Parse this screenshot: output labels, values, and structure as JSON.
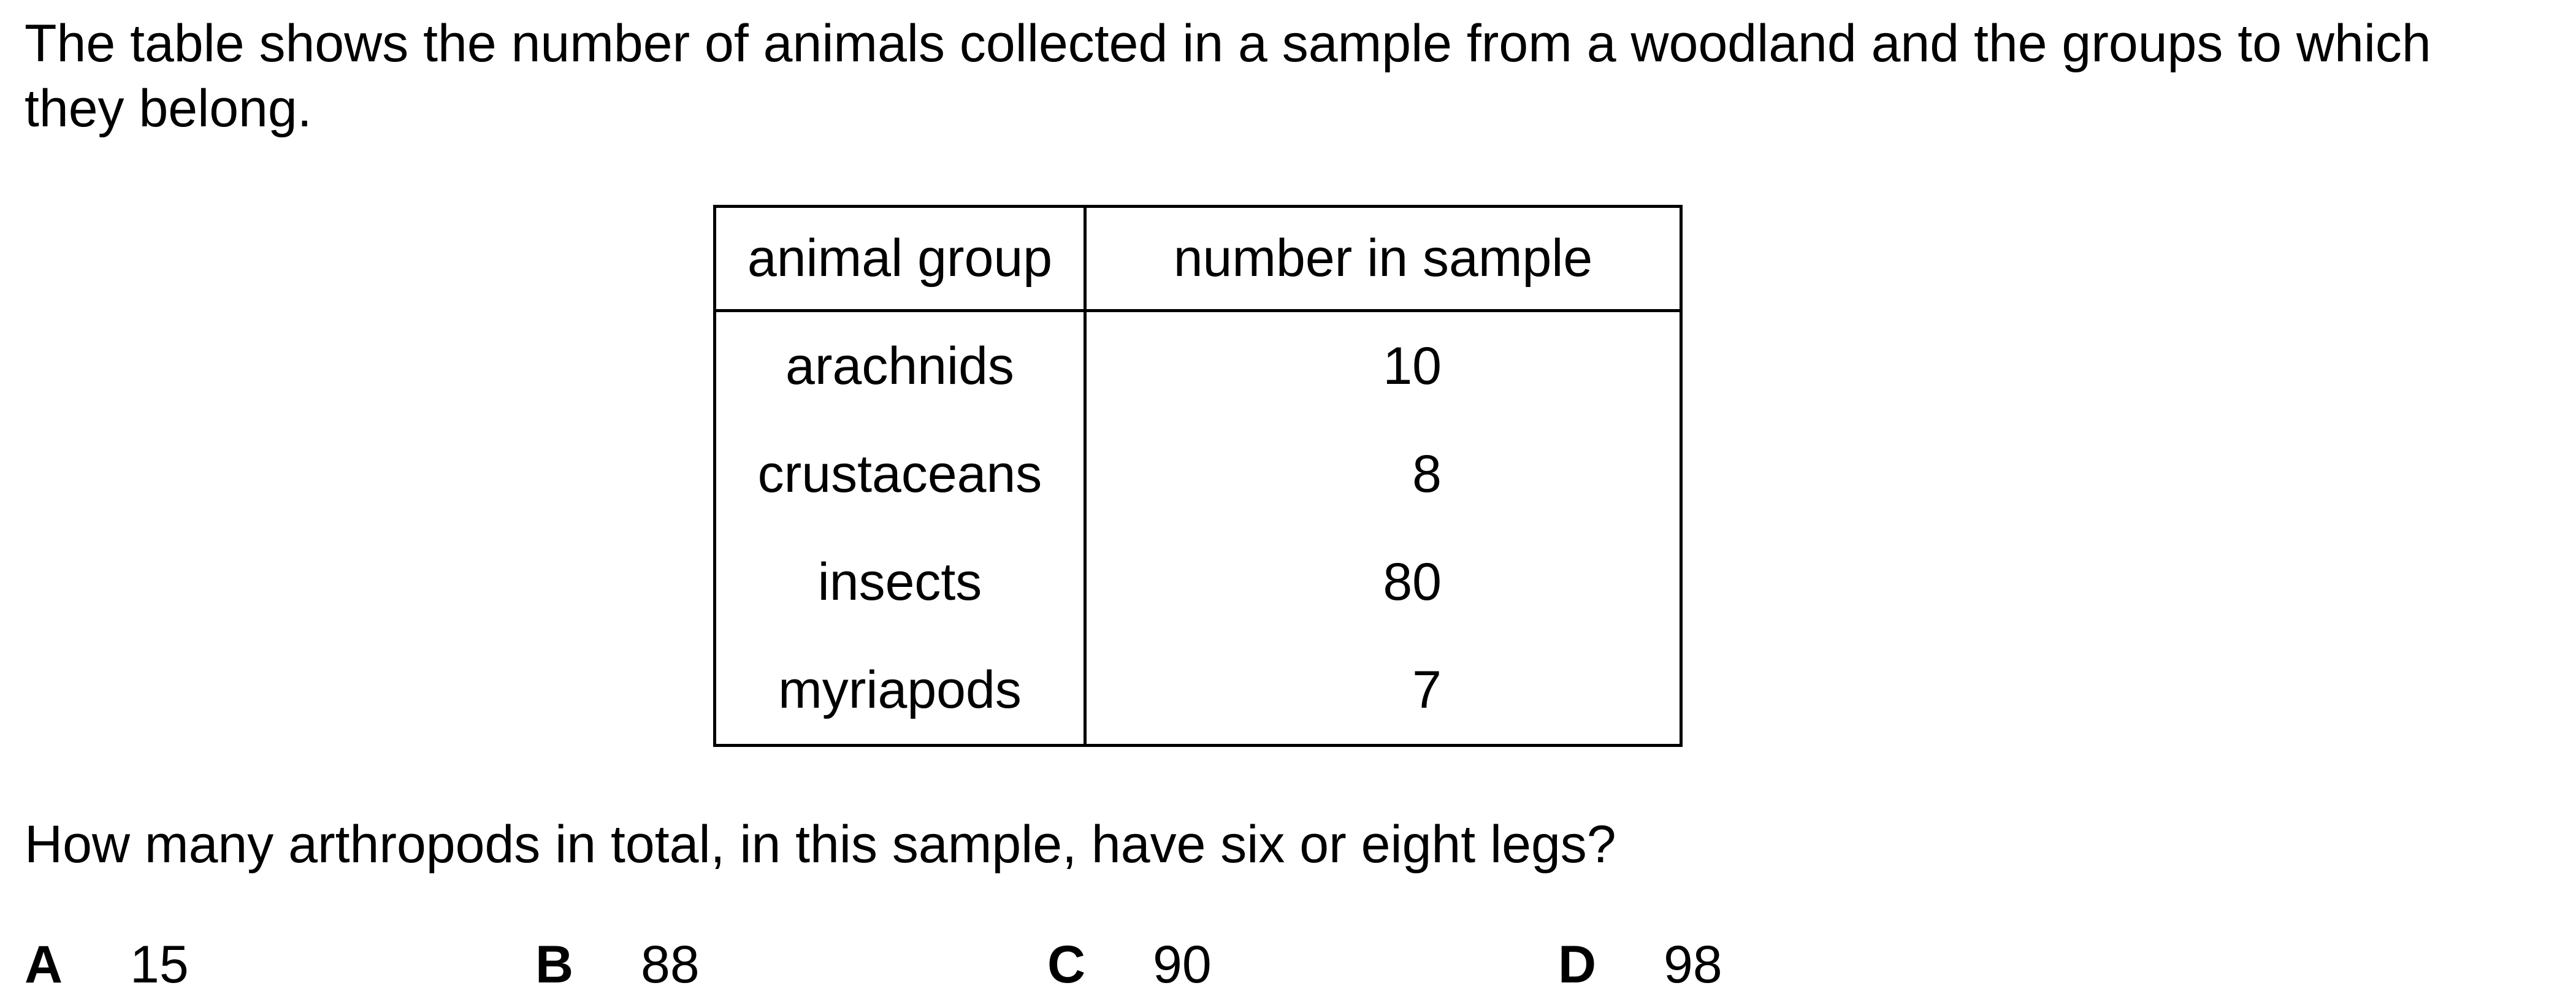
{
  "intro": "The table shows the number of animals collected in a sample from a woodland and the groups to which they belong.",
  "table": {
    "headers": [
      "animal group",
      "number in sample"
    ],
    "rows": [
      {
        "group": "arachnids",
        "number": "10"
      },
      {
        "group": "crustaceans",
        "number": "8"
      },
      {
        "group": "insects",
        "number": "80"
      },
      {
        "group": "myriapods",
        "number": "7"
      }
    ]
  },
  "question": "How many arthropods in total, in this sample, have six or eight legs?",
  "options": [
    {
      "letter": "A",
      "value": "15"
    },
    {
      "letter": "B",
      "value": "88"
    },
    {
      "letter": "C",
      "value": "90"
    },
    {
      "letter": "D",
      "value": "98"
    }
  ]
}
